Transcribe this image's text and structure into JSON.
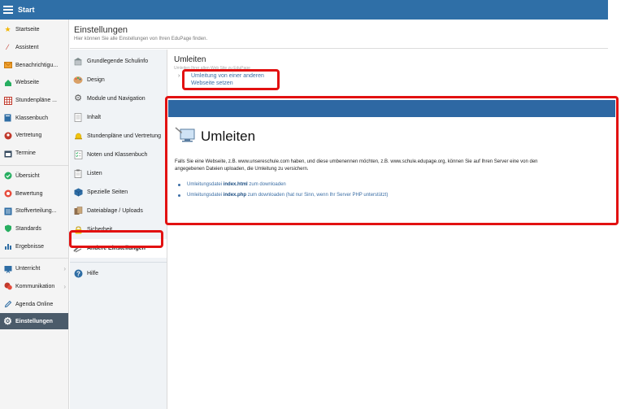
{
  "app": {
    "title": "Start"
  },
  "sidebar": {
    "items": [
      {
        "label": "Startseite",
        "icon": "star-icon",
        "color": "#f2b705"
      },
      {
        "label": "Assistent",
        "icon": "wand-icon",
        "color": "#c0392b"
      },
      {
        "label": "Benachrichtigu...",
        "icon": "mail-icon",
        "color": "#e67e22"
      },
      {
        "label": "Webseite",
        "icon": "home-icon",
        "color": "#27ae60"
      },
      {
        "label": "Stundenpläne ...",
        "icon": "grid-icon",
        "color": "#c0392b"
      },
      {
        "label": "Klassenbuch",
        "icon": "book-icon",
        "color": "#2e6da4"
      },
      {
        "label": "Vertretung",
        "icon": "person-icon",
        "color": "#c0392b"
      },
      {
        "label": "Termine",
        "icon": "calendar-icon",
        "color": "#34495e"
      }
    ],
    "items2": [
      {
        "label": "Übersicht",
        "icon": "check-circle-icon",
        "color": "#27ae60"
      },
      {
        "label": "Bewertung",
        "icon": "target-icon",
        "color": "#e74c3c"
      },
      {
        "label": "Stoffverteilung...",
        "icon": "list-icon",
        "color": "#2e6da4"
      },
      {
        "label": "Standards",
        "icon": "shield-icon",
        "color": "#27ae60"
      },
      {
        "label": "Ergebnisse",
        "icon": "chart-icon",
        "color": "#2e6da4"
      }
    ],
    "items3": [
      {
        "label": "Unterricht",
        "icon": "board-icon",
        "color": "#2e6da4",
        "arrow": "›"
      },
      {
        "label": "Kommunikation",
        "icon": "chat-icon",
        "color": "#c0392b",
        "arrow": "›"
      },
      {
        "label": "Agenda Online",
        "icon": "pen-icon",
        "color": "#2e6da4"
      }
    ],
    "active": {
      "label": "Einstellungen",
      "icon": "gear-icon"
    }
  },
  "header": {
    "title": "Einstellungen",
    "subtitle": "Hier können Sie alle Einstellungen von Ihren EduPage finden."
  },
  "settings_menu": {
    "items": [
      {
        "label": "Grundlegende Schulinfo",
        "icon": "school-icon"
      },
      {
        "label": "Design",
        "icon": "palette-icon"
      },
      {
        "label": "Module und Navigation",
        "icon": "gear-icon"
      },
      {
        "label": "Inhalt",
        "icon": "document-icon"
      },
      {
        "label": "Stundenpläne und Vertretung",
        "icon": "bell-icon"
      },
      {
        "label": "Noten und Klassenbuch",
        "icon": "checklist-icon"
      },
      {
        "label": "Listen",
        "icon": "clipboard-icon"
      },
      {
        "label": "Spezielle Seiten",
        "icon": "cube-icon"
      },
      {
        "label": "Dateiablage / Uploads",
        "icon": "files-icon"
      },
      {
        "label": "Sicherheit",
        "icon": "lock-icon"
      },
      {
        "label": "Andere Einstellungen",
        "icon": "tools-icon",
        "active": true
      }
    ],
    "help": {
      "label": "Hilfe",
      "icon": "help-icon"
    }
  },
  "content": {
    "title": "Umleiten",
    "subtitle": "Umleiten Ihrer alten Web Site zu EduPage",
    "link_line1": "Umleitung von einer anderen",
    "link_line2": "Webseite setzen"
  },
  "popup": {
    "title": "Umleiten",
    "icon": "computer-redirect-icon",
    "text": "Falls Sie eine Webseite, z.B. www.unsereschule.com haben, und diese umbenennen möchten, z.B. www.schule.edupage.org, können Sie auf Ihren Server eine von den angegebenen Dateien uploaden, die Umleitung zu versichern.",
    "links": [
      {
        "prefix": "Umleitungsdatei",
        "file": "index.html",
        "suffix": "zum downloaden"
      },
      {
        "prefix": "Umleitungsdatei",
        "file": "index.php",
        "suffix": "zum downloaden (hat nur Sinn, wenn Ihr Server PHP unterstützt)"
      }
    ]
  },
  "colors": {
    "topbar": "#2f6fa7",
    "highlight": "#e21111",
    "link": "#3b6ea5"
  }
}
